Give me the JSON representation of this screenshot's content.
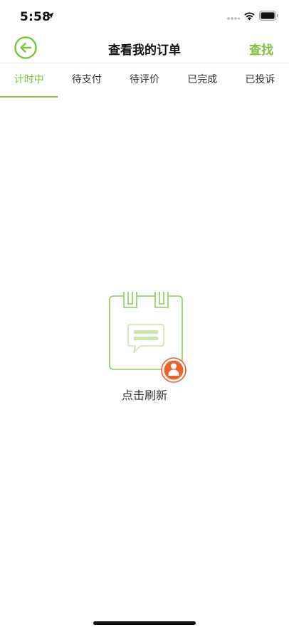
{
  "status_bar": {
    "time": "5:58"
  },
  "nav": {
    "title": "查看我的订单",
    "action_label": "查找"
  },
  "tabs": [
    {
      "label": "计时中",
      "active": true
    },
    {
      "label": "待支付",
      "active": false
    },
    {
      "label": "待评价",
      "active": false
    },
    {
      "label": "已完成",
      "active": false
    },
    {
      "label": "已投诉",
      "active": false
    }
  ],
  "empty_state": {
    "label": "点击刷新"
  },
  "colors": {
    "accent": "#7cc43a",
    "badge": "#e8642c"
  }
}
